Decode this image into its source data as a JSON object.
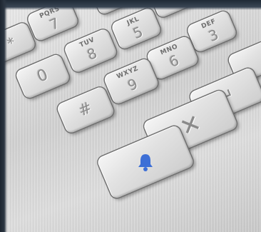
{
  "keypad": {
    "keys": [
      {
        "id": "star",
        "digit": "*",
        "letters": ""
      },
      {
        "id": "7",
        "digit": "7",
        "letters": "PQRS"
      },
      {
        "id": "5",
        "digit": "5",
        "letters": "JKL"
      },
      {
        "id": "3",
        "digit": "3",
        "letters": "DEF"
      },
      {
        "id": "0",
        "digit": "0",
        "letters": ""
      },
      {
        "id": "8",
        "digit": "8",
        "letters": "TUV"
      },
      {
        "id": "6",
        "digit": "6",
        "letters": "MNO"
      },
      {
        "id": "9",
        "digit": "9",
        "letters": "WXYZ"
      },
      {
        "id": "hash",
        "digit": "#",
        "letters": ""
      },
      {
        "id": "cancel",
        "symbol": "✕"
      },
      {
        "id": "enter",
        "symbol": "↵"
      },
      {
        "id": "bell",
        "icon": "bell-icon",
        "icon_color": "#3d6fd6"
      }
    ]
  }
}
